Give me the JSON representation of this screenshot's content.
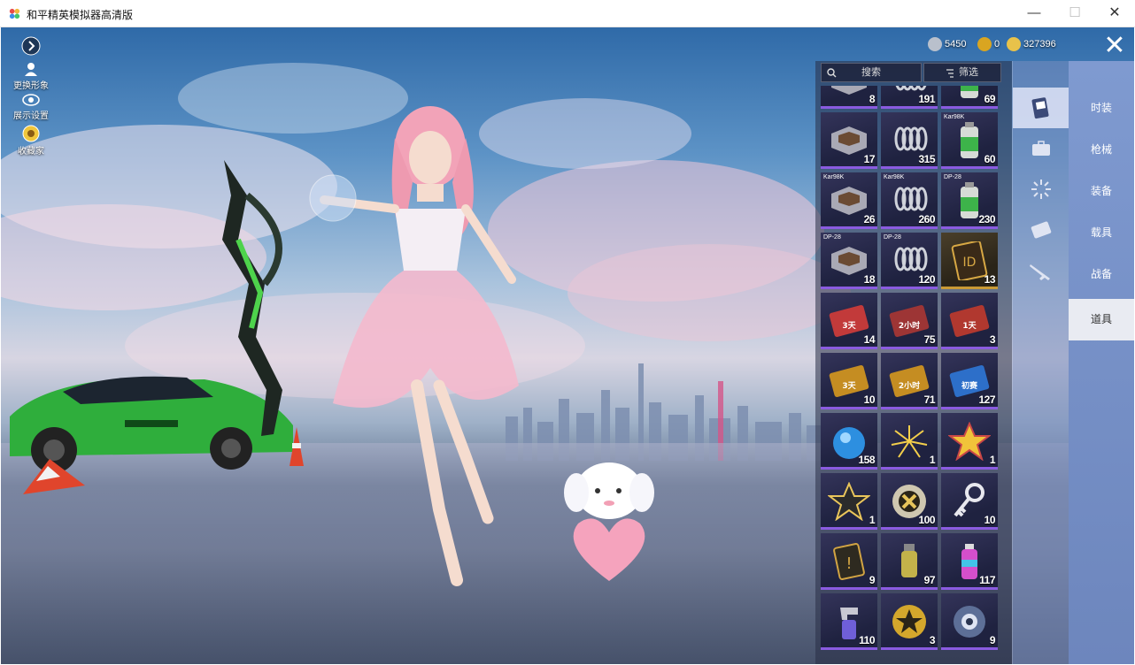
{
  "window": {
    "title": "和平精英模拟器高清版",
    "minimize": "—",
    "maximize": "☐",
    "close": "✕"
  },
  "hud": {
    "expand_icon": "chevron-right-icon",
    "change_avatar": "更换形象",
    "display_settings": "展示设置",
    "collector": "收藏家"
  },
  "currency": [
    {
      "icon": "silver-coin-icon",
      "value": "5450",
      "color": "#b9c0cc"
    },
    {
      "icon": "ag-coin-icon",
      "value": "0",
      "color": "#d9a521"
    },
    {
      "icon": "uc-coin-icon",
      "value": "327396",
      "color": "#e8c24a"
    }
  ],
  "close_label": "✕",
  "inventory": {
    "search_placeholder": "搜索",
    "filter_label": "筛选",
    "items": [
      {
        "name": "crate-item",
        "tag": "",
        "count": "8",
        "rarity": "purple"
      },
      {
        "name": "spring-item",
        "tag": "",
        "count": "191",
        "rarity": "purple"
      },
      {
        "name": "green-canister-item",
        "tag": "",
        "count": "69",
        "rarity": "purple"
      },
      {
        "name": "crate-item",
        "tag": "",
        "count": "17",
        "rarity": "purple"
      },
      {
        "name": "spring-item",
        "tag": "",
        "count": "315",
        "rarity": "purple"
      },
      {
        "name": "green-canister-item",
        "tag": "Kar98K",
        "count": "60",
        "rarity": "purple"
      },
      {
        "name": "crate-item",
        "tag": "Kar98K",
        "count": "26",
        "rarity": "purple"
      },
      {
        "name": "spring-item",
        "tag": "Kar98K",
        "count": "260",
        "rarity": "purple"
      },
      {
        "name": "green-canister-item",
        "tag": "DP-28",
        "count": "230",
        "rarity": "purple"
      },
      {
        "name": "crate-item",
        "tag": "DP-28",
        "count": "18",
        "rarity": "purple"
      },
      {
        "name": "spring-item",
        "tag": "DP-28",
        "count": "120",
        "rarity": "purple"
      },
      {
        "name": "id-card-item",
        "tag": "",
        "count": "13",
        "rarity": "gold"
      },
      {
        "name": "ticket-3day-item",
        "tag": "",
        "count": "14",
        "rarity": "purple"
      },
      {
        "name": "ticket-2hour-item",
        "tag": "",
        "count": "75",
        "rarity": "purple"
      },
      {
        "name": "ticket-1day-item",
        "tag": "",
        "count": "3",
        "rarity": "purple"
      },
      {
        "name": "gold-ticket-3day-item",
        "tag": "",
        "count": "10",
        "rarity": "purple"
      },
      {
        "name": "gold-ticket-2hour-item",
        "tag": "",
        "count": "71",
        "rarity": "purple"
      },
      {
        "name": "entry-card-item",
        "tag": "",
        "count": "127",
        "rarity": "purple"
      },
      {
        "name": "blue-orb-item",
        "tag": "",
        "count": "158",
        "rarity": "purple"
      },
      {
        "name": "firework-item",
        "tag": "",
        "count": "1",
        "rarity": "purple"
      },
      {
        "name": "gold-star-item",
        "tag": "",
        "count": "1",
        "rarity": "purple"
      },
      {
        "name": "silver-star-item",
        "tag": "",
        "count": "1",
        "rarity": "purple"
      },
      {
        "name": "gold-coin-item",
        "tag": "",
        "count": "100",
        "rarity": "purple"
      },
      {
        "name": "key-item",
        "tag": "",
        "count": "10",
        "rarity": "purple"
      },
      {
        "name": "warning-card-item",
        "tag": "",
        "count": "9",
        "rarity": "purple"
      },
      {
        "name": "grenade-item",
        "tag": "",
        "count": "97",
        "rarity": "purple"
      },
      {
        "name": "spray-can-item",
        "tag": "",
        "count": "117",
        "rarity": "purple"
      },
      {
        "name": "spray-gun-item",
        "tag": "",
        "count": "110",
        "rarity": "purple"
      },
      {
        "name": "star-medal-item",
        "tag": "",
        "count": "3",
        "rarity": "purple"
      },
      {
        "name": "gear-badge-item",
        "tag": "",
        "count": "9",
        "rarity": "purple"
      }
    ],
    "ticket_labels": {
      "3day": "3天",
      "2hour": "2小时",
      "1day": "1天",
      "entry": "初赛"
    }
  },
  "category_icons": [
    {
      "icon": "card-icon",
      "active": true
    },
    {
      "icon": "briefcase-icon",
      "active": false
    },
    {
      "icon": "burst-icon",
      "active": false
    },
    {
      "icon": "ticket-icon",
      "active": false
    },
    {
      "icon": "rifle-icon",
      "active": false
    }
  ],
  "tabs": [
    {
      "label": "时装",
      "active": false
    },
    {
      "label": "枪械",
      "active": false
    },
    {
      "label": "装备",
      "active": false
    },
    {
      "label": "载具",
      "active": false
    },
    {
      "label": "战备",
      "active": false
    },
    {
      "label": "道具",
      "active": true
    }
  ]
}
